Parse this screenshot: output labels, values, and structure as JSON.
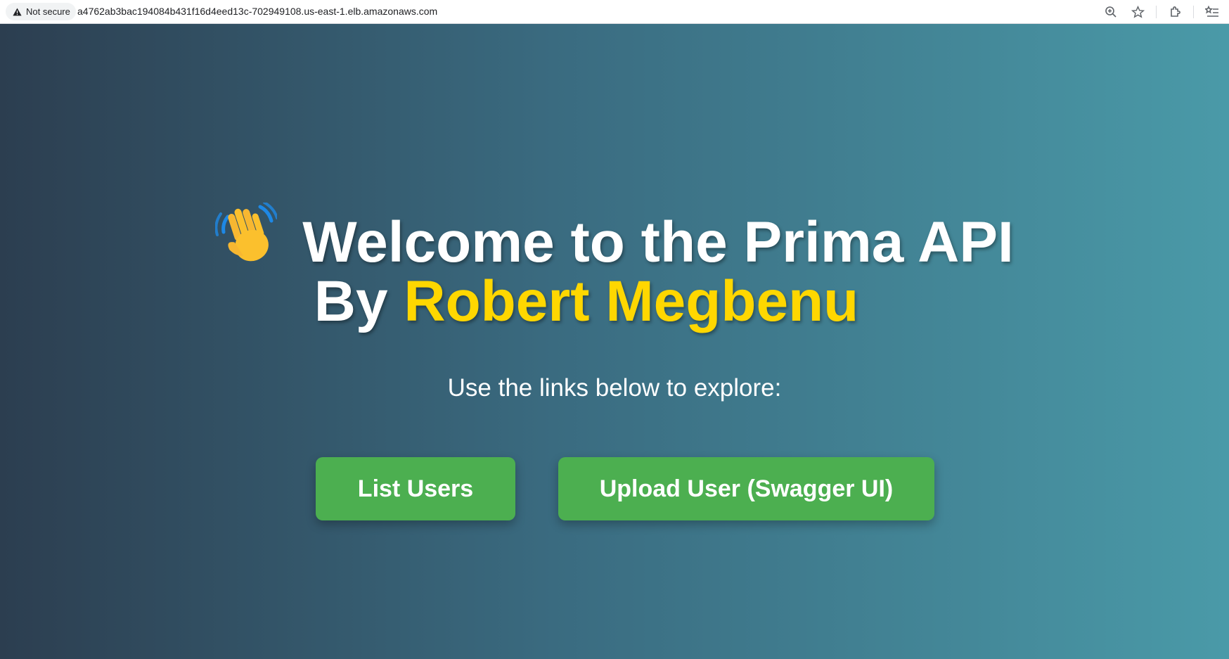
{
  "browser": {
    "security_label": "Not secure",
    "url": "a4762ab3bac194084b431f16d4eed13c-702949108.us-east-1.elb.amazonaws.com",
    "icons": [
      "zoom-icon",
      "bookmark-star-icon",
      "extensions-icon",
      "reading-list-icon"
    ]
  },
  "hero": {
    "emoji": "👋",
    "title_line1": "Welcome to the Prima API",
    "by_label": "By",
    "author": "Robert Megbenu",
    "subtitle": "Use the links below to explore:"
  },
  "buttons": {
    "list_users": "List Users",
    "upload_user": "Upload User (Swagger UI)"
  },
  "colors": {
    "gradient_start": "#2c3e50",
    "gradient_end": "#4a9aa8",
    "author_accent": "#ffd700",
    "button_green": "#4caf50"
  }
}
